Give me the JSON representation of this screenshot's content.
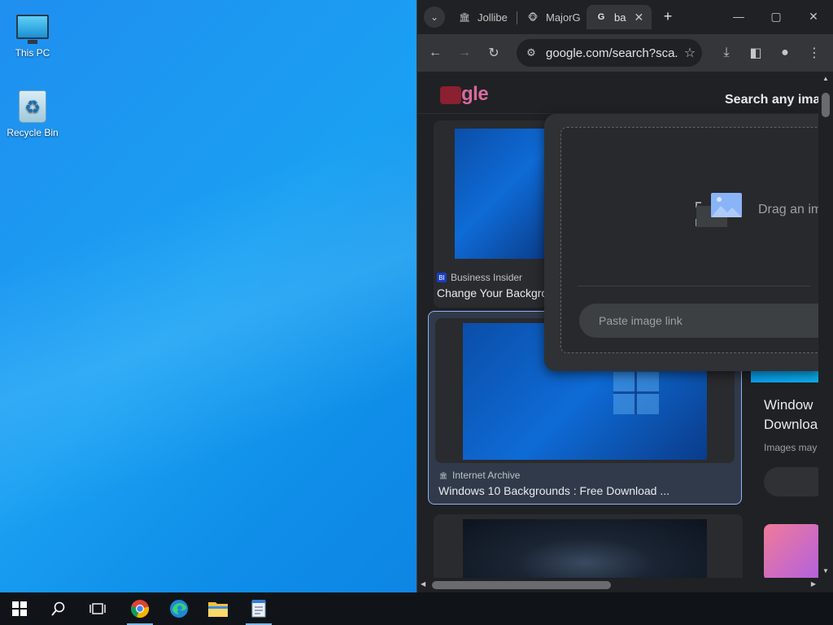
{
  "desktop": {
    "icons": [
      {
        "label": "This PC"
      },
      {
        "label": "Recycle Bin"
      }
    ]
  },
  "browser": {
    "tabs": [
      {
        "label": "Jollibe",
        "icon": "building-icon"
      },
      {
        "label": "MajorG",
        "icon": "mascot-icon"
      },
      {
        "label": "ba",
        "icon": "google-icon",
        "active": true
      }
    ],
    "url": "google.com/search?sca...",
    "google_logo": "gle",
    "lens_title": "Search any imag",
    "drag_text": "Drag an im",
    "paste_placeholder": "Paste image link",
    "results": [
      {
        "source": "Business Insider",
        "title": "Change Your Backgro"
      },
      {
        "source": "Internet Archive",
        "title": "Windows 10 Backgrounds : Free Download ..."
      }
    ],
    "side_result": {
      "title_line1": "Window",
      "title_line2": "Downloa",
      "note": "Images may"
    }
  },
  "taskbar": {
    "items": [
      "start-icon",
      "search-icon",
      "task-view-icon",
      "chrome-icon",
      "edge-icon",
      "file-explorer-icon",
      "notepad-icon"
    ]
  }
}
